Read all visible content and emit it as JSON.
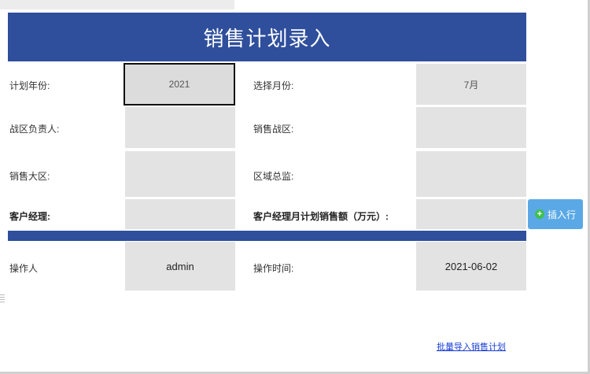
{
  "form": {
    "title": "销售计划录入",
    "rows": [
      {
        "left_label": "计划年份:",
        "left_value": "2021",
        "right_label": "选择月份:",
        "right_value": "7月"
      },
      {
        "left_label": "战区负责人:",
        "left_value": "",
        "right_label": "销售战区:",
        "right_value": ""
      },
      {
        "left_label": "销售大区:",
        "left_value": "",
        "right_label": "区域总监:",
        "right_value": ""
      },
      {
        "left_label": "客户经理:",
        "left_value": "",
        "right_label": "客户经理月计划销售额（万元）:",
        "right_value": ""
      }
    ],
    "insert_button_label": "插入行",
    "operator_label": "操作人",
    "operator_value": "admin",
    "operate_time_label": "操作时间:",
    "operate_time_value": "2021-06-02",
    "batch_import_link": "批量导入销售计划",
    "colors": {
      "header_bg": "#2f4f9c",
      "cell_bg": "#e3e3e3",
      "button_bg": "#5aa9e6",
      "plus_icon": "#3fbf4f",
      "link": "#1a3fd6"
    }
  }
}
